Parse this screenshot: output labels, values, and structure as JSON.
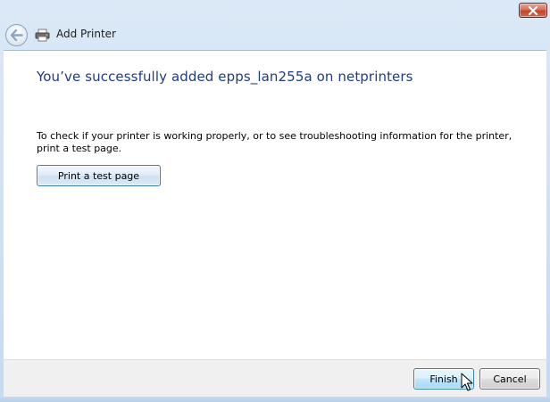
{
  "window": {
    "title": "Add Printer",
    "close_icon": "close-icon",
    "back_icon": "back-arrow-icon",
    "app_icon": "printer-icon"
  },
  "main": {
    "heading": "You’ve successfully added epps_lan255a on netprinters",
    "description": "To check if your printer is working properly, or to see troubleshooting information for the printer, print a test page.",
    "test_page_button": "Print a test page"
  },
  "footer": {
    "finish_label": "Finish",
    "cancel_label": "Cancel"
  },
  "colors": {
    "heading": "#1e3c8c",
    "frame": "#cfe0f3",
    "close_button": "#c2452c"
  }
}
